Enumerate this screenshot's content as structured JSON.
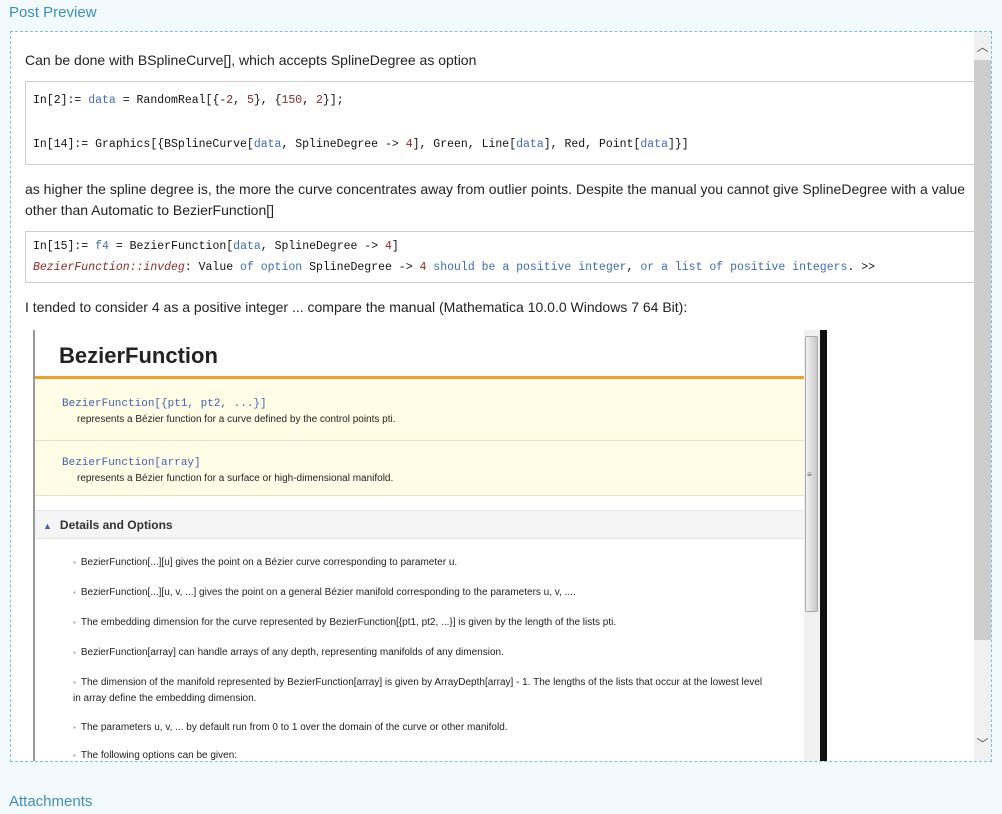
{
  "header": {
    "title": "Post Preview"
  },
  "post": {
    "p1": "Can be done with BSplineCurve[], which accepts SplineDegree as option",
    "code1": [
      [
        [
          "In[2]:= ",
          ""
        ],
        [
          "data",
          "b"
        ],
        [
          " = RandomReal[{-",
          ""
        ],
        [
          "2",
          "r"
        ],
        [
          ", ",
          ""
        ],
        [
          "5",
          "r"
        ],
        [
          "}, {",
          ""
        ],
        [
          "150",
          "r"
        ],
        [
          ", ",
          ""
        ],
        [
          "2",
          "r"
        ],
        [
          "}];",
          ""
        ]
      ],
      [
        [
          "",
          ""
        ]
      ],
      [
        [
          "In[14]:= Graphics[{BSplineCurve[",
          ""
        ],
        [
          "data",
          "b"
        ],
        [
          ", SplineDegree -> ",
          ""
        ],
        [
          "4",
          "r"
        ],
        [
          "], Green, Line[",
          ""
        ],
        [
          "data",
          "b"
        ],
        [
          "], Red, Point[",
          ""
        ],
        [
          "data",
          "b"
        ],
        [
          "]}]",
          ""
        ]
      ]
    ],
    "p2": "as higher the spline degree is, the more the curve concentrates away from outlier points. Despite the manual you cannot give SplineDegree with a value other than Automatic to BezierFunction[]",
    "code2": [
      [
        [
          "In[15]:= ",
          ""
        ],
        [
          "f4",
          "b"
        ],
        [
          " = BezierFunction[",
          ""
        ],
        [
          "data",
          "b"
        ],
        [
          ", SplineDegree -> ",
          ""
        ],
        [
          "4",
          "r"
        ],
        [
          "]",
          ""
        ]
      ],
      [
        [
          "BezierFunction::invdeg",
          "i"
        ],
        [
          ": Value ",
          ""
        ],
        [
          "of option",
          "b"
        ],
        [
          " SplineDegree -> ",
          ""
        ],
        [
          "4",
          "r"
        ],
        [
          " should be a positive integer",
          "b"
        ],
        [
          ", ",
          ""
        ],
        [
          "or a list of positive integers",
          "b"
        ],
        [
          ". >>",
          ""
        ]
      ]
    ],
    "p3": "I tended to consider 4 as a positive integer ... compare the manual (Mathematica 10.0.0 Windows 7 64 Bit):"
  },
  "doc": {
    "title": "BezierFunction",
    "usage": [
      {
        "sig": "BezierFunction[{pt1, pt2, ...}]",
        "desc": "represents a Bézier function for a curve defined by the control points pti."
      },
      {
        "sig": "BezierFunction[array]",
        "desc": "represents a Bézier function for a surface or high-dimensional manifold."
      }
    ],
    "details_title": "Details and Options",
    "bullets": [
      "BezierFunction[...][u] gives the point on a Bézier curve corresponding to parameter u.",
      "BezierFunction[...][u, v, ...] gives the point on a general Bézier manifold corresponding to the parameters u, v, ....",
      "The embedding dimension for the curve represented by BezierFunction[{pt1, pt2, ...}] is given by the length of the lists pti.",
      "BezierFunction[array] can handle arrays of any depth, representing manifolds of any dimension.",
      "The dimension of the manifold represented by BezierFunction[array] is given by ArrayDepth[array] - 1. The lengths of the lists that occur at the lowest level in array define the embedding dimension.",
      "The parameters u, v, ... by default run from 0 to 1 over the domain of the curve or other manifold.",
      "The following options can be given:"
    ]
  },
  "attachments": {
    "title": "Attachments"
  },
  "colors": {
    "accent": "#3c8dbc",
    "doc_orange": "#f5a01a",
    "doc_yellow": "#fffde6"
  }
}
